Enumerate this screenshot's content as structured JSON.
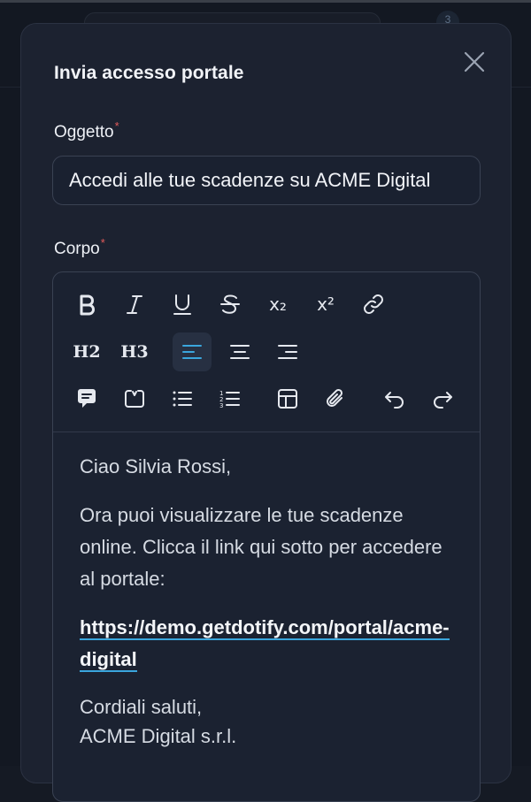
{
  "background": {
    "badge_count": "3"
  },
  "modal": {
    "title": "Invia accesso portale",
    "subject": {
      "label": "Oggetto",
      "required_mark": "*",
      "value": "Accedi alle tue scadenze su ACME Digital"
    },
    "body": {
      "label": "Corpo",
      "required_mark": "*",
      "toolbar": {
        "h2_label": "H2",
        "h3_label": "H3",
        "subscript_label": "x₂",
        "superscript_label": "x²"
      },
      "content": {
        "greeting": "Ciao Silvia Rossi,",
        "message": "Ora puoi visualizzare le tue scadenze online. Clicca il link qui sotto per accedere al portale:",
        "link": "https://demo.getdotify.com/portal/acme-digital",
        "signoff": "Cordiali saluti,",
        "company": "ACME Digital s.r.l."
      }
    }
  },
  "colors": {
    "accent": "#3aa6dd",
    "required": "#e25b5b",
    "modal_bg": "#1c2230",
    "active_button_bg": "#273042"
  }
}
